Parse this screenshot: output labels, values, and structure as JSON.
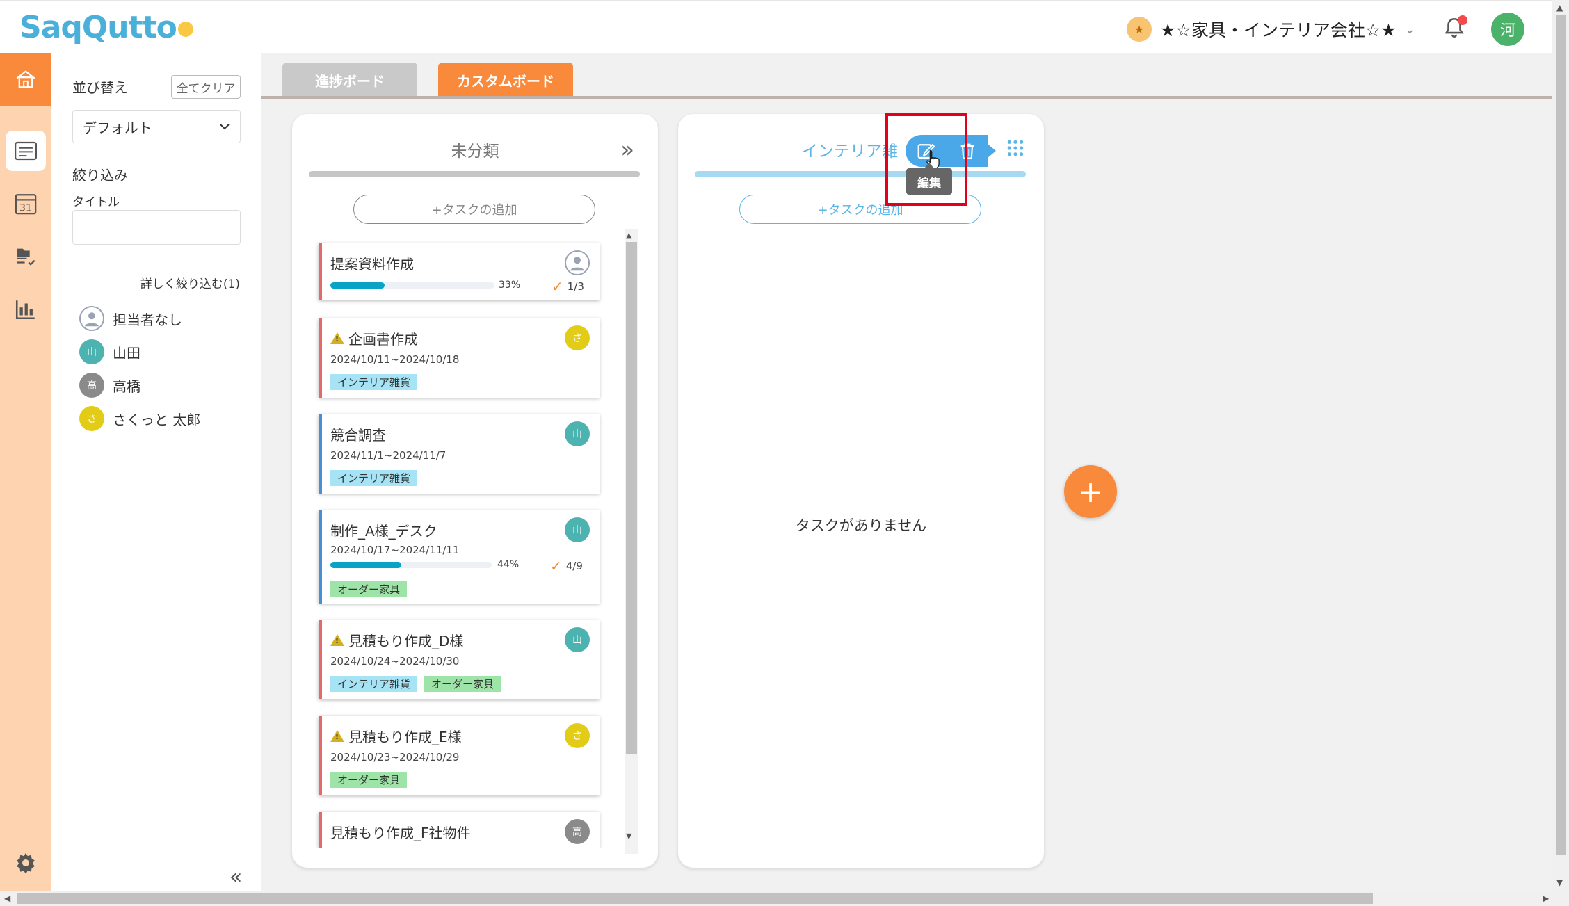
{
  "header": {
    "logo_text": "SaqQutto",
    "company_name": "★☆家具・インテリア会社☆★",
    "company_badge": "★",
    "user_initial": "河"
  },
  "filters": {
    "sort_label": "並び替え",
    "clear_all": "全てクリア",
    "sort_value": "デフォルト",
    "filter_label": "絞り込み",
    "title_label": "タイトル",
    "title_value": "",
    "detail_link": "詳しく絞り込む(1)",
    "assignees": [
      {
        "avatar": "",
        "name": "担当者なし"
      },
      {
        "avatar": "山",
        "name": "山田"
      },
      {
        "avatar": "高",
        "name": "高橋"
      },
      {
        "avatar": "さ",
        "name": "さくっと 太郎"
      }
    ]
  },
  "tabs": {
    "progress_board": "進捗ボード",
    "custom_board": "カスタムボード"
  },
  "columns": [
    {
      "title": "未分類",
      "add_task": "+タスクの追加",
      "cards": [
        {
          "title": "提案資料作成",
          "avatar": "",
          "progress_pct": "33%",
          "progress": 0.33,
          "checklist": "1/3"
        },
        {
          "title": "企画書作成",
          "warning": true,
          "date": "2024/10/11~2024/10/18",
          "avatar": "さ",
          "tags": [
            "インテリア雑貨"
          ]
        },
        {
          "title": "競合調査",
          "date": "2024/11/1~2024/11/7",
          "avatar": "山",
          "tags": [
            "インテリア雑貨"
          ]
        },
        {
          "title": "制作_A様_デスク",
          "date": "2024/10/17~2024/11/11",
          "avatar": "山",
          "progress_pct": "44%",
          "progress": 0.44,
          "checklist": "4/9",
          "tags": [
            "オーダー家具"
          ]
        },
        {
          "title": "見積もり作成_D様",
          "warning": true,
          "date": "2024/10/24~2024/10/30",
          "avatar": "山",
          "tags": [
            "インテリア雑貨",
            "オーダー家具"
          ]
        },
        {
          "title": "見積もり作成_E様",
          "warning": true,
          "date": "2024/10/23~2024/10/29",
          "avatar": "さ",
          "tags": [
            "オーダー家具"
          ]
        },
        {
          "title": "見積もり作成_F社物件",
          "avatar": "高"
        }
      ]
    },
    {
      "title": "インテリア雑",
      "add_task": "+タスクの追加",
      "empty_message": "タスクがありません",
      "tooltip": "編集"
    }
  ],
  "colors": {
    "accent_orange": "#f98a3c",
    "brand_blue": "#4ab0d9",
    "interior_tag": "#a6e3f4",
    "order_tag": "#9ee4a8"
  }
}
